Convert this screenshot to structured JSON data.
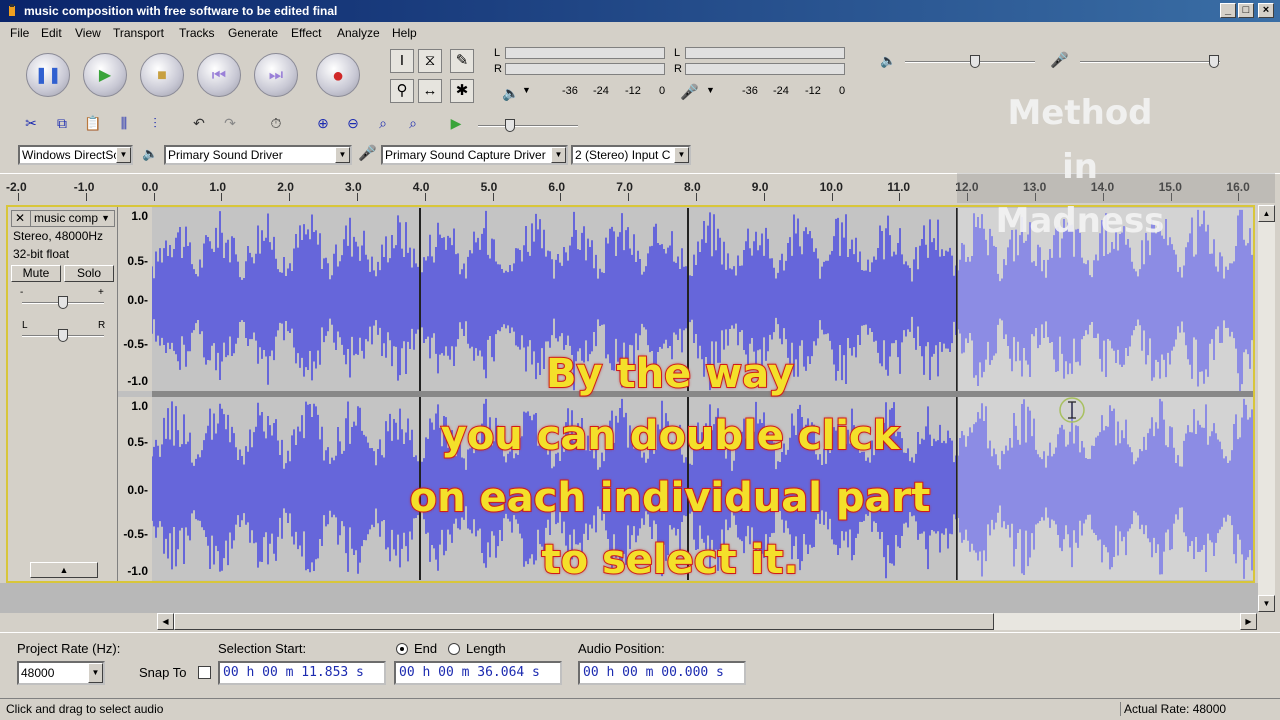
{
  "window": {
    "title": "music composition with free software to be edited final",
    "min": "_",
    "max": "□",
    "close": "×"
  },
  "menu": [
    "File",
    "Edit",
    "View",
    "Transport",
    "Tracks",
    "Generate",
    "Effect",
    "Analyze",
    "Help"
  ],
  "meters": {
    "playback_ticks": [
      "-36",
      "-24",
      "-12",
      "0"
    ],
    "record_ticks": [
      "-36",
      "-24",
      "-12",
      "0"
    ],
    "channel_l": "L",
    "channel_r": "R"
  },
  "device": {
    "host": "Windows DirectSc",
    "playback": "Primary Sound Driver",
    "recording": "Primary Sound Capture Driver",
    "channels": "2 (Stereo) Input C"
  },
  "ruler": {
    "ticks": [
      "-2.0",
      "-1.0",
      "0.0",
      "1.0",
      "2.0",
      "3.0",
      "4.0",
      "5.0",
      "6.0",
      "7.0",
      "8.0",
      "9.0",
      "10.0",
      "11.0",
      "12.0",
      "13.0",
      "14.0",
      "15.0",
      "16.0"
    ]
  },
  "track": {
    "name": "music comp",
    "info1": "Stereo, 48000Hz",
    "info2": "32-bit float",
    "mute": "Mute",
    "solo": "Solo",
    "gain_minus": "-",
    "gain_plus": "+",
    "pan_l": "L",
    "pan_r": "R",
    "collapse": "▲",
    "scale": [
      "1.0",
      "0.5-",
      "0.0-",
      "-0.5-",
      "-1.0"
    ]
  },
  "overlay": [
    "By the way",
    "you can double click",
    "on each individual part",
    "to select it."
  ],
  "watermark": [
    "Method",
    "in",
    "Madness"
  ],
  "selection": {
    "project_rate_label": "Project Rate (Hz):",
    "project_rate": "48000",
    "snap_to": "Snap To",
    "selection_start_label": "Selection Start:",
    "end_label": "End",
    "length_label": "Length",
    "audio_position_label": "Audio Position:",
    "start_value": "00 h 00 m 11.853 s",
    "end_value": "00 h 00 m 36.064 s",
    "position_value": "00 h 00 m 00.000 s"
  },
  "status": {
    "left": "Click and drag to select audio",
    "right": "Actual Rate: 48000"
  },
  "colors": {
    "waveform": "#4f4fe0",
    "title_bar": "#0a246a",
    "overlay_text": "#f4e02a",
    "overlay_stroke": "#d8201a"
  }
}
